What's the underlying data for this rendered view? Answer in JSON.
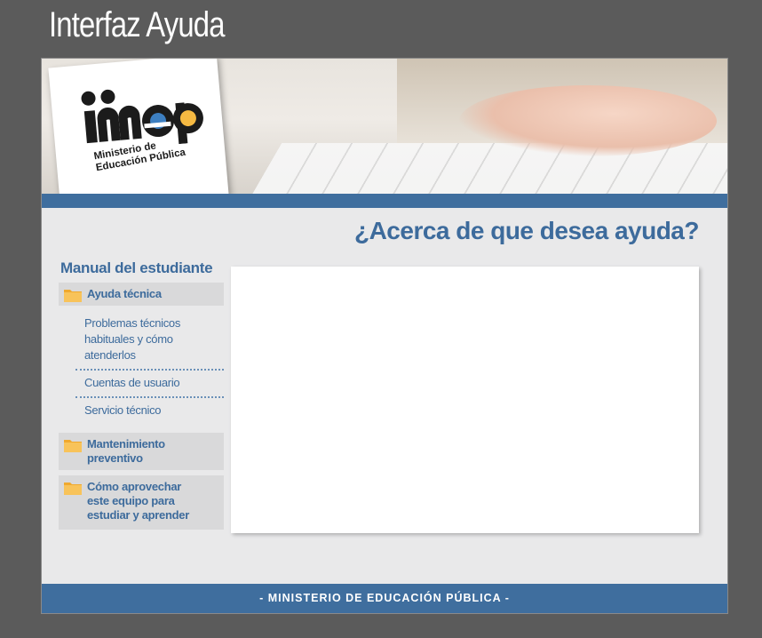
{
  "page_title": "Interfaz Ayuda",
  "logo": {
    "brand": "mep",
    "line1": "Ministerio de",
    "line2": "Educación Pública"
  },
  "question": "¿Acerca de que desea ayuda?",
  "sidebar": {
    "title": "Manual del estudiante",
    "categories": [
      {
        "label": "Ayuda técnica",
        "items": [
          "Problemas técnicos habituales y cómo atenderlos",
          "Cuentas de usuario",
          "Servicio técnico"
        ]
      },
      {
        "label": "Mantenimiento preventivo",
        "items": []
      },
      {
        "label": "Cómo aprovechar este equipo para estudiar y aprender",
        "items": []
      }
    ]
  },
  "footer": "- MINISTERIO DE EDUCACIÓN PÚBLICA -",
  "colors": {
    "accent": "#3d6b9c",
    "bar": "#3f6e9e",
    "folder": "#f5b942",
    "background": "#5b5b5b"
  }
}
